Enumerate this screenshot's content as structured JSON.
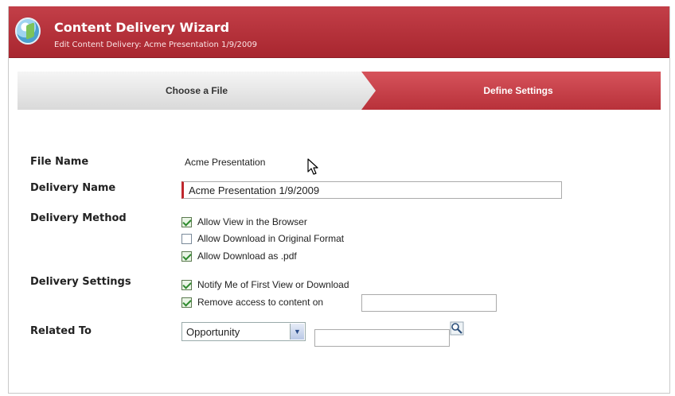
{
  "header": {
    "title": "Content Delivery Wizard",
    "subtitle": "Edit Content Delivery: Acme Presentation 1/9/2009"
  },
  "steps": {
    "step1": "Choose a File",
    "step2": "Define Settings"
  },
  "form": {
    "file_name_label": "File Name",
    "file_name_value": "Acme Presentation",
    "delivery_name_label": "Delivery Name",
    "delivery_name_value": "Acme Presentation 1/9/2009",
    "delivery_method_label": "Delivery Method",
    "delivery_methods": [
      {
        "label": "Allow View in the Browser",
        "checked": true
      },
      {
        "label": "Allow Download in Original Format",
        "checked": false
      },
      {
        "label": "Allow Download as .pdf",
        "checked": true
      }
    ],
    "delivery_settings_label": "Delivery Settings",
    "delivery_settings": [
      {
        "label": "Notify Me of First View or Download",
        "checked": true
      },
      {
        "label": "Remove access to content on",
        "checked": true
      }
    ],
    "remove_access_date": "",
    "related_to_label": "Related To",
    "related_to_selected": "Opportunity",
    "related_to_value": ""
  },
  "colors": {
    "accent": "#b8313a",
    "header_bg": "#c33f48"
  },
  "icons": {
    "logo": "content-delivery-logo",
    "lookup": "lookup-magnifier-icon",
    "cursor": "mouse-pointer"
  }
}
